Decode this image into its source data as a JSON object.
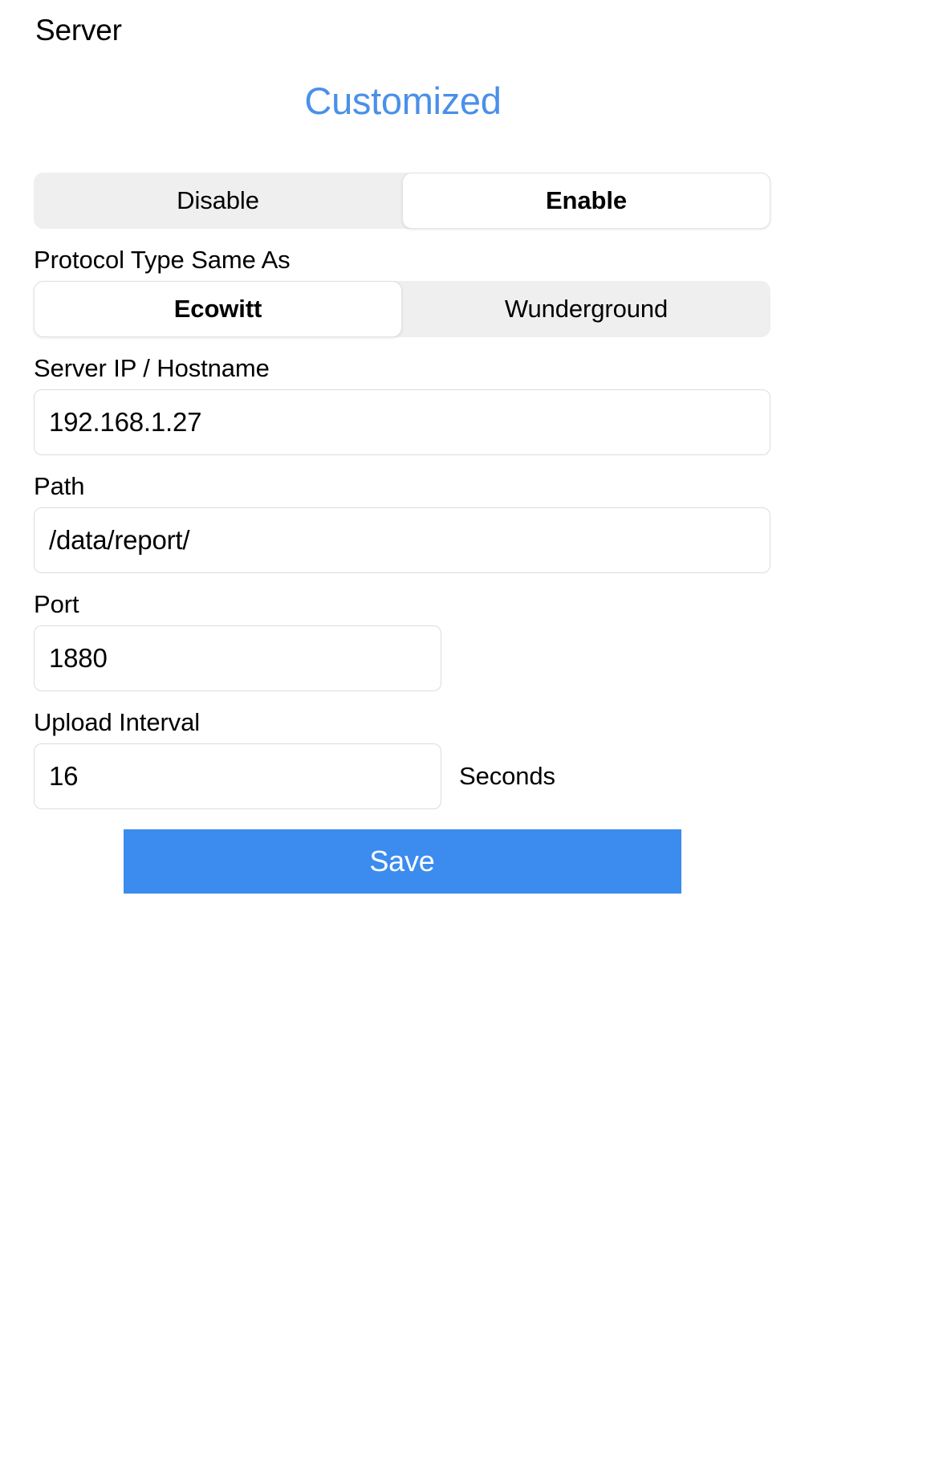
{
  "page": {
    "title": "Server",
    "heading": "Customized"
  },
  "enable_toggle": {
    "name": "enable-state",
    "options": [
      "Disable",
      "Enable"
    ],
    "selected": "Enable",
    "selected_index": 1
  },
  "protocol": {
    "label": "Protocol Type Same As",
    "options": [
      "Ecowitt",
      "Wunderground"
    ],
    "selected": "Ecowitt",
    "selected_index": 0
  },
  "fields": {
    "server_ip": {
      "label": "Server IP / Hostname",
      "value": "192.168.1.27",
      "placeholder": ""
    },
    "path": {
      "label": "Path",
      "value": "/data/report/",
      "placeholder": ""
    },
    "port": {
      "label": "Port",
      "value": "1880",
      "placeholder": ""
    },
    "upload_interval": {
      "label": "Upload Interval",
      "value": "16",
      "placeholder": "",
      "unit": "Seconds"
    }
  },
  "actions": {
    "save_label": "Save"
  },
  "colors": {
    "accent_blue": "#4a90e8",
    "button_blue": "#3b8cee",
    "segment_track": "#efefef",
    "input_border": "#dcdcdc"
  }
}
